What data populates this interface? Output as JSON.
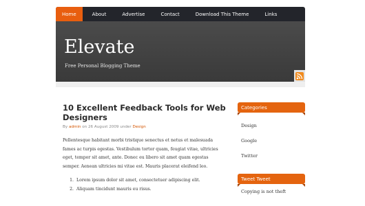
{
  "nav": {
    "items": [
      {
        "label": "Home"
      },
      {
        "label": "About"
      },
      {
        "label": "Advertise"
      },
      {
        "label": "Contact"
      },
      {
        "label": "Download This Theme"
      },
      {
        "label": "Links"
      }
    ]
  },
  "header": {
    "title": "Elevate",
    "tagline": "Free Personal Blogging Theme"
  },
  "post": {
    "title": "10 Excellent Feedback Tools for Web Designers",
    "meta_by": "By",
    "author": "admin",
    "meta_on": "on 26 August 2009 under",
    "category": "Design",
    "paragraph": "Pellentesque habitant morbi tristique senectus et netus et malesuada fames ac turpis egestas. Vestibulum tortor quam, feugiat vitae, ultricies eget, tempor sit amet, ante. Donec eu libero sit amet quam egestas semper. Aenean ultricies mi vitae est. Mauris placerat eleifend leo.",
    "list": [
      {
        "num": "1.",
        "text": "Lorem ipsum dolor sit amet, consectetuer adipiscing elit."
      },
      {
        "num": "2.",
        "text": "Aliquam tincidunt mauris eu risus."
      }
    ]
  },
  "sidebar": {
    "categories_title": "Categories",
    "categories": [
      {
        "label": "Design"
      },
      {
        "label": "Google"
      },
      {
        "label": "Twitter"
      }
    ],
    "tweet_title": "Tweet Tweet",
    "tweet_text": "Copying is not theft"
  },
  "colors": {
    "accent": "#e4640f",
    "nav_bg": "#23252b",
    "header_bg": "#454545"
  }
}
